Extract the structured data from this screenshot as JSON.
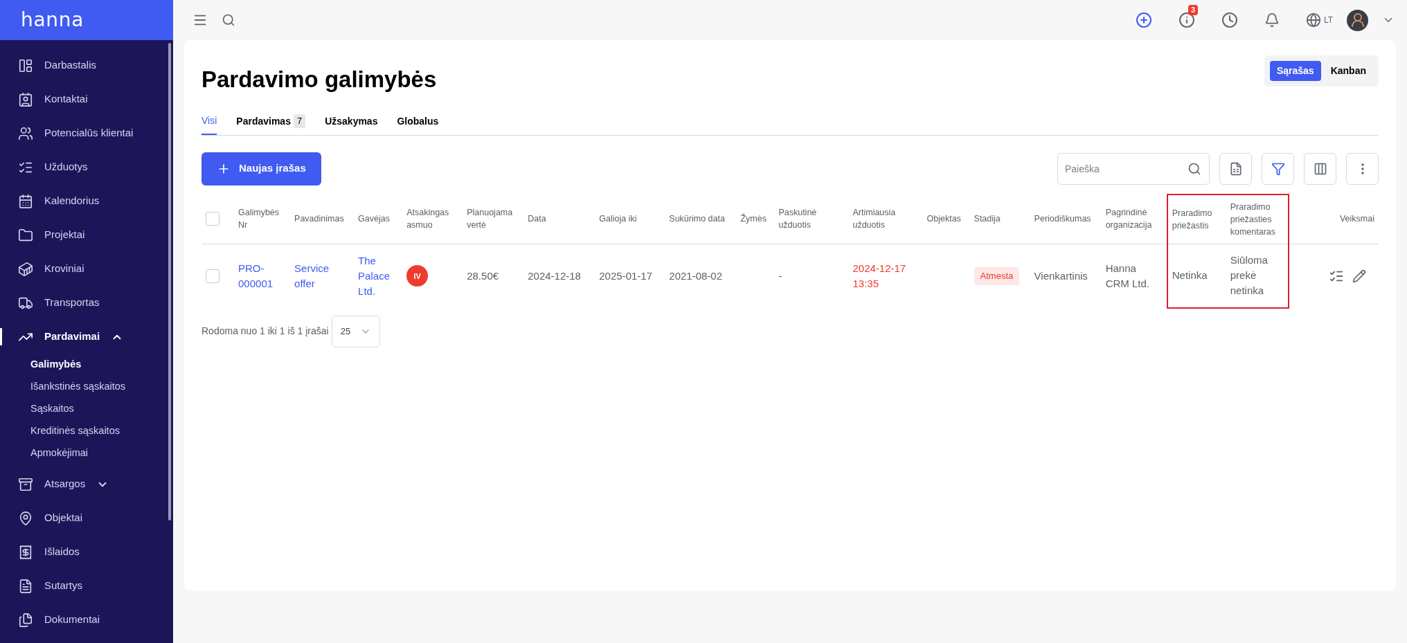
{
  "sidebar": {
    "logo": "hanna",
    "items": [
      {
        "label": "Darbastalis",
        "selected": false
      },
      {
        "label": "Kontaktai",
        "selected": false
      },
      {
        "label": "Potencialūs klientai",
        "selected": false
      },
      {
        "label": "Užduotys",
        "selected": false
      },
      {
        "label": "Kalendorius",
        "selected": false
      },
      {
        "label": "Projektai",
        "selected": false
      },
      {
        "label": "Kroviniai",
        "selected": false
      },
      {
        "label": "Transportas",
        "selected": false
      },
      {
        "label": "Pardavimai",
        "selected": true,
        "expanded": true,
        "children": [
          {
            "label": "Galimybės",
            "selected": true
          },
          {
            "label": "Išankstinės sąskaitos",
            "selected": false
          },
          {
            "label": "Sąskaitos",
            "selected": false
          },
          {
            "label": "Kreditinės sąskaitos",
            "selected": false
          },
          {
            "label": "Apmokėjimai",
            "selected": false
          }
        ]
      },
      {
        "label": "Atsargos",
        "selected": false,
        "expanded": false
      },
      {
        "label": "Objektai",
        "selected": false
      },
      {
        "label": "Išlaidos",
        "selected": false
      },
      {
        "label": "Sutartys",
        "selected": false
      },
      {
        "label": "Dokumentai",
        "selected": false
      }
    ]
  },
  "topbar": {
    "notifications_badge": "3",
    "language": "LT"
  },
  "page": {
    "title": "Pardavimo galimybės",
    "view_toggle": [
      {
        "label": "Sąrašas",
        "selected": true
      },
      {
        "label": "Kanban",
        "selected": false
      }
    ],
    "tabs": [
      {
        "label": "Visi",
        "selected": true
      },
      {
        "label": "Pardavimas",
        "count": "7",
        "selected": false
      },
      {
        "label": "Užsakymas",
        "selected": false
      },
      {
        "label": "Globalus",
        "selected": false
      }
    ],
    "new_button": "Naujas įrašas",
    "search": {
      "placeholder": "Paieška"
    },
    "table": {
      "columns": [
        {
          "kind": "checkbox",
          "checked": false
        },
        {
          "kind": "text",
          "label": "Galimybės Nr"
        },
        {
          "kind": "text",
          "label": "Pavadinimas"
        },
        {
          "kind": "text",
          "label": "Gavėjas"
        },
        {
          "kind": "text",
          "label": "Atsakingas asmuo"
        },
        {
          "kind": "text",
          "label": "Planuojama vertė"
        },
        {
          "kind": "text",
          "label": "Data"
        },
        {
          "kind": "text",
          "label": "Galioja iki"
        },
        {
          "kind": "text",
          "label": "Sukūrimo data"
        },
        {
          "kind": "text",
          "label": "Žymės"
        },
        {
          "kind": "text",
          "label": "Paskutinė užduotis"
        },
        {
          "kind": "text",
          "label": "Artimiausia užduotis"
        },
        {
          "kind": "text",
          "label": "Objektas"
        },
        {
          "kind": "text",
          "label": "Stadija"
        },
        {
          "kind": "text",
          "label": "Periodiškumas"
        },
        {
          "kind": "text",
          "label": "Pagrindinė organizacija"
        },
        {
          "kind": "text",
          "label": "Praradimo priežastis",
          "highlighted": true
        },
        {
          "kind": "text",
          "label": "Praradimo priežasties komentaras",
          "highlighted": true
        },
        {
          "kind": "text",
          "label": "Veiksmai"
        }
      ],
      "rows": [
        {
          "cells": [
            {
              "kind": "checkbox",
              "checked": false
            },
            {
              "kind": "link",
              "text": "PRO-000001"
            },
            {
              "kind": "link",
              "text": "Service offer"
            },
            {
              "kind": "link",
              "text": "The Palace Ltd."
            },
            {
              "kind": "avatar",
              "text": "IV",
              "color": "#ef3b2d"
            },
            {
              "kind": "text",
              "text": "28.50€"
            },
            {
              "kind": "text",
              "text": "2024-12-18"
            },
            {
              "kind": "text",
              "text": "2025-01-17"
            },
            {
              "kind": "text",
              "text": "2021-08-02"
            },
            {
              "kind": "empty"
            },
            {
              "kind": "text",
              "text": "-"
            },
            {
              "kind": "overdue",
              "text": "2024-12-17 13:35"
            },
            {
              "kind": "empty"
            },
            {
              "kind": "badge",
              "text": "Atmesta"
            },
            {
              "kind": "text",
              "text": "Vienkartinis"
            },
            {
              "kind": "text",
              "text": "Hanna CRM Ltd."
            },
            {
              "kind": "text",
              "text": "Netinka"
            },
            {
              "kind": "text",
              "text": "Siūloma prekė netinka"
            },
            {
              "kind": "actions"
            }
          ]
        }
      ]
    },
    "footer": {
      "summary": "Rodoma nuo 1 iki 1 iš 1 įrašai",
      "page_size": "25"
    }
  }
}
